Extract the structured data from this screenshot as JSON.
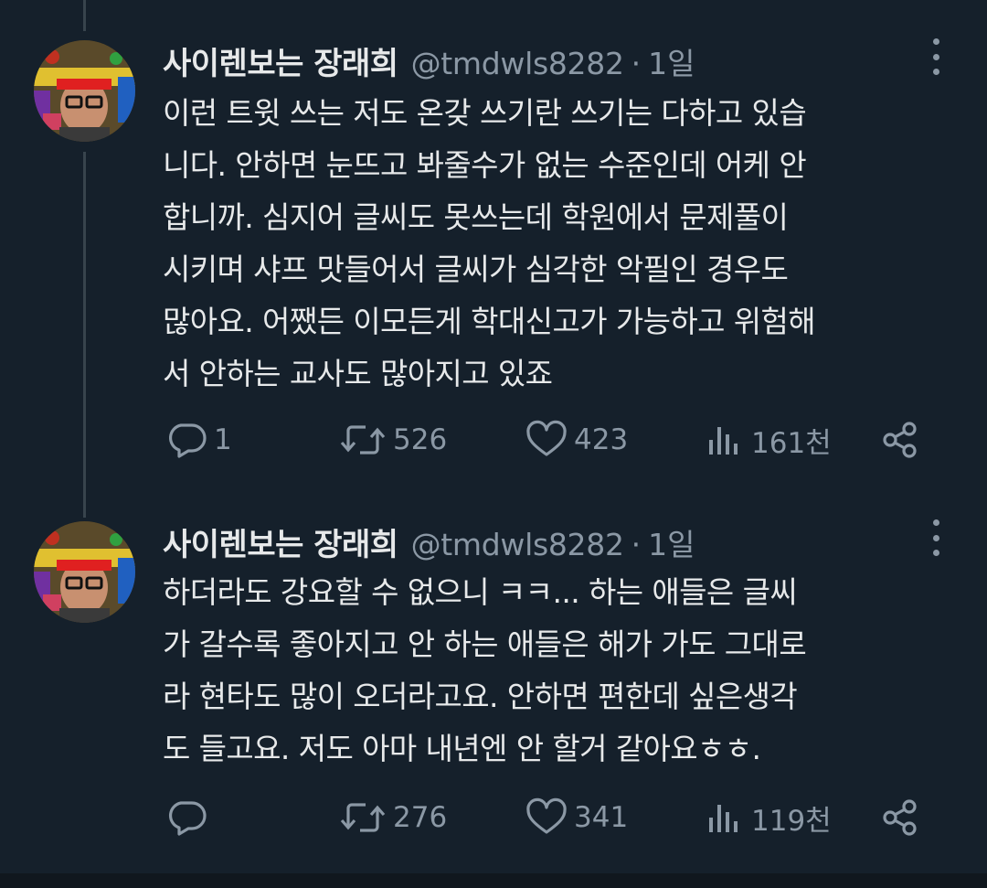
{
  "tweets": [
    {
      "author_name": "사이렌보는 장래희",
      "handle": "@tmdwls8282",
      "separator": "·",
      "time": "1일",
      "lines": [
        "이런 트윗 쓰는 저도 온갖 쓰기란 쓰기는 다하고 있습",
        "니다. 안하면 눈뜨고 봐줄수가 없는 수준인데 어케 안",
        "합니까. 심지어 글씨도 못쓰는데 학원에서 문제풀이",
        "시키며 샤프 맛들어서 글씨가 심각한 악필인 경우도",
        "많아요. 어쨌든 이모든게 학대신고가 가능하고 위험해",
        "서 안하는 교사도 많아지고 있죠"
      ],
      "replies": "1",
      "retweets": "526",
      "likes": "423",
      "views": "161천"
    },
    {
      "author_name": "사이렌보는 장래희",
      "handle": "@tmdwls8282",
      "separator": "·",
      "time": "1일",
      "lines": [
        "하더라도 강요할 수 없으니 ㅋㅋ... 하는 애들은 글씨",
        "가 갈수록 좋아지고 안 하는 애들은 해가 가도 그대로",
        "라 현타도 많이 오더라고요. 안하면 편한데 싶은생각",
        "도 들고요. 저도 아마 내년엔 안 할거 같아요ㅎㅎ."
      ],
      "replies": "",
      "retweets": "276",
      "likes": "341",
      "views": "119천"
    }
  ],
  "icons": {
    "reply": "reply-icon",
    "retweet": "retweet-icon",
    "like": "heart-icon",
    "views": "views-icon",
    "share": "share-icon",
    "more": "more-icon"
  },
  "colors": {
    "background": "#15202b",
    "text": "#e7e9ea",
    "secondary": "#8b98a5",
    "thread_line": "#38444d"
  }
}
